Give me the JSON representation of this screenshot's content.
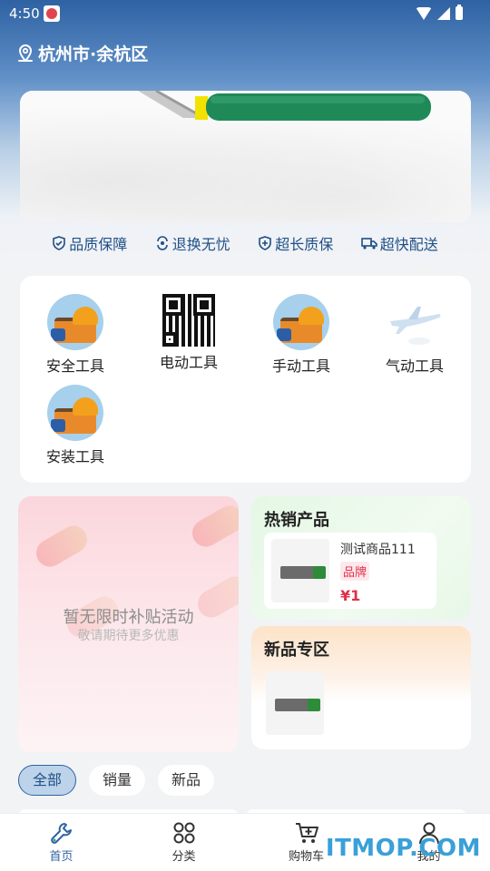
{
  "status_bar": {
    "time": "4:50"
  },
  "location": {
    "text": "杭州市·余杭区"
  },
  "features": [
    {
      "label": "品质保障",
      "icon": "shield-check-icon"
    },
    {
      "label": "退换无忧",
      "icon": "exchange-icon"
    },
    {
      "label": "超长质保",
      "icon": "shield-plus-icon"
    },
    {
      "label": "超快配送",
      "icon": "truck-icon"
    }
  ],
  "categories": [
    {
      "label": "安全工具",
      "icon": "toolbox-icon"
    },
    {
      "label": "电动工具",
      "icon": "qr-code-icon"
    },
    {
      "label": "手动工具",
      "icon": "toolbox-icon"
    },
    {
      "label": "气动工具",
      "icon": "airplane-icon"
    },
    {
      "label": "安装工具",
      "icon": "toolbox-icon"
    }
  ],
  "subsidy": {
    "title": "暂无限时补贴活动",
    "subtitle": "敬请期待更多优惠"
  },
  "hot": {
    "title": "热销产品",
    "product": {
      "name": "测试商品111",
      "brand": "品牌",
      "price": "¥1"
    }
  },
  "new": {
    "title": "新品专区"
  },
  "filters": [
    "全部",
    "销量",
    "新品"
  ],
  "nav": [
    {
      "label": "首页",
      "icon": "wrench-icon"
    },
    {
      "label": "分类",
      "icon": "grid-icon"
    },
    {
      "label": "购物车",
      "icon": "cart-icon"
    },
    {
      "label": "我的",
      "icon": "user-icon"
    }
  ],
  "watermark": "ITMOP.COM",
  "colors": {
    "primary": "#2f62a3",
    "price": "#e0314a"
  }
}
